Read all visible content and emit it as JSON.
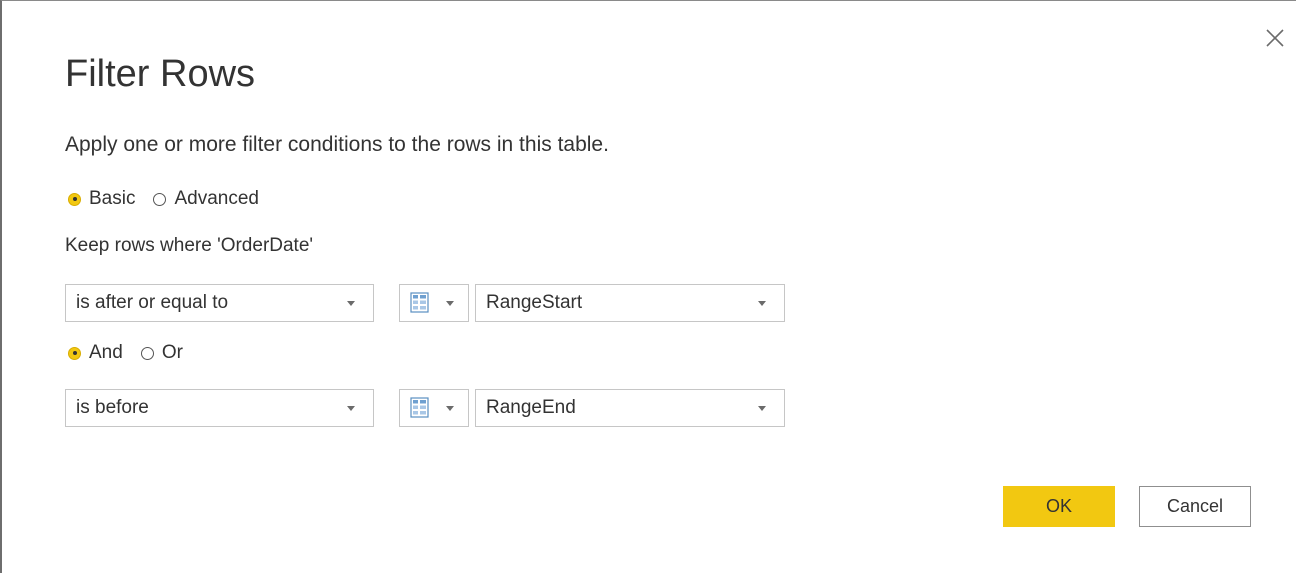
{
  "dialog": {
    "title": "Filter Rows",
    "subtitle": "Apply one or more filter conditions to the rows in this table."
  },
  "mode": {
    "options": [
      {
        "label": "Basic",
        "checked": true
      },
      {
        "label": "Advanced",
        "checked": false
      }
    ]
  },
  "keep_rows_label": "Keep rows where 'OrderDate'",
  "conditions": [
    {
      "operator": "is after or equal to",
      "value_type_icon": "parameter-grid-icon",
      "value": "RangeStart"
    },
    {
      "operator": "is before",
      "value_type_icon": "parameter-grid-icon",
      "value": "RangeEnd"
    }
  ],
  "combinator": {
    "options": [
      {
        "label": "And",
        "checked": true
      },
      {
        "label": "Or",
        "checked": false
      }
    ]
  },
  "buttons": {
    "ok": "OK",
    "cancel": "Cancel"
  },
  "colors": {
    "accent": "#f2c811",
    "text": "#333333",
    "border": "#c6c6c6"
  }
}
